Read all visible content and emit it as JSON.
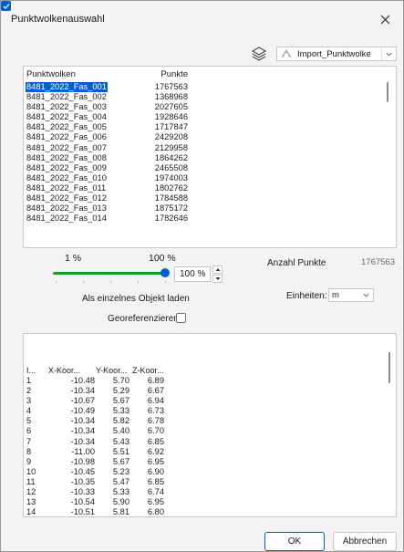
{
  "window": {
    "title": "Punktwolkenauswahl"
  },
  "toolbar": {
    "cloud_selector_value": "Import_Punktwolke"
  },
  "cloud_list": {
    "headers": {
      "name": "Punktwolken",
      "points": "Punkte"
    },
    "rows": [
      {
        "name": "8481_2022_Fas_001",
        "points": "1767563"
      },
      {
        "name": "8481_2022_Fas_002",
        "points": "1368968"
      },
      {
        "name": "8481_2022_Fas_003",
        "points": "2027605"
      },
      {
        "name": "8481_2022_Fas_004",
        "points": "1928646"
      },
      {
        "name": "8481_2022_Fas_005",
        "points": "1717847"
      },
      {
        "name": "8481_2022_Fas_006",
        "points": "2429208"
      },
      {
        "name": "8481_2022_Fas_007",
        "points": "2129958"
      },
      {
        "name": "8481_2022_Fas_008",
        "points": "1864262"
      },
      {
        "name": "8481_2022_Fas_009",
        "points": "2465508"
      },
      {
        "name": "8481_2022_Fas_010",
        "points": "1974003"
      },
      {
        "name": "8481_2022_Fas_011",
        "points": "1802762"
      },
      {
        "name": "8481_2022_Fas_012",
        "points": "1784588"
      },
      {
        "name": "8481_2022_Fas_013",
        "points": "1875172"
      },
      {
        "name": "8481_2022_Fas_014",
        "points": "1782646"
      }
    ],
    "selected_index": 0
  },
  "density": {
    "min_label": "1 %",
    "max_label": "100 %",
    "value": "100 %",
    "slider_fraction": 1.0
  },
  "point_count": {
    "label": "Anzahl Punkte",
    "value": "1767563"
  },
  "options": {
    "single_object_label": "Als einzelnes Objekt laden",
    "single_object_checked": true,
    "georef_label": "Georeferenzieren",
    "georef_checked": false
  },
  "units": {
    "label": "Einheiten:",
    "value": "m"
  },
  "coord_table": {
    "headers": {
      "i": "I...",
      "x": "X-Koor...",
      "y": "Y-Koor...",
      "z": "Z-Koor..."
    },
    "rows": [
      {
        "i": "1",
        "x": "-10.48",
        "y": "5.70",
        "z": "6.89"
      },
      {
        "i": "2",
        "x": "-10.34",
        "y": "5.29",
        "z": "6.67"
      },
      {
        "i": "3",
        "x": "-10.67",
        "y": "5.67",
        "z": "6.94"
      },
      {
        "i": "4",
        "x": "-10.49",
        "y": "5.33",
        "z": "6.73"
      },
      {
        "i": "5",
        "x": "-10.34",
        "y": "5.82",
        "z": "6.78"
      },
      {
        "i": "6",
        "x": "-10.34",
        "y": "5.40",
        "z": "6.70"
      },
      {
        "i": "7",
        "x": "-10.34",
        "y": "5.43",
        "z": "6.85"
      },
      {
        "i": "8",
        "x": "-11.00",
        "y": "5.51",
        "z": "6.92"
      },
      {
        "i": "9",
        "x": "-10.98",
        "y": "5.67",
        "z": "6.95"
      },
      {
        "i": "10",
        "x": "-10.45",
        "y": "5.23",
        "z": "6.90"
      },
      {
        "i": "11",
        "x": "-10.35",
        "y": "5.47",
        "z": "6.85"
      },
      {
        "i": "12",
        "x": "-10.33",
        "y": "5.33",
        "z": "6.74"
      },
      {
        "i": "13",
        "x": "-10.54",
        "y": "5.90",
        "z": "6.95"
      },
      {
        "i": "14",
        "x": "-10.51",
        "y": "5.81",
        "z": "6.80"
      }
    ]
  },
  "buttons": {
    "ok": "OK",
    "cancel": "Abbrechen"
  },
  "icons": {
    "close": "close-icon",
    "layers": "layers-icon",
    "point_cloud": "point-cloud-icon",
    "dropdown": "chevron-down-icon",
    "spin_up": "spin-up-icon",
    "spin_down": "spin-down-icon",
    "checkmark": "checkmark-icon"
  },
  "colors": {
    "selection": "#0060d0",
    "slider_fill": "#14a014",
    "accent": "#0060d0"
  }
}
